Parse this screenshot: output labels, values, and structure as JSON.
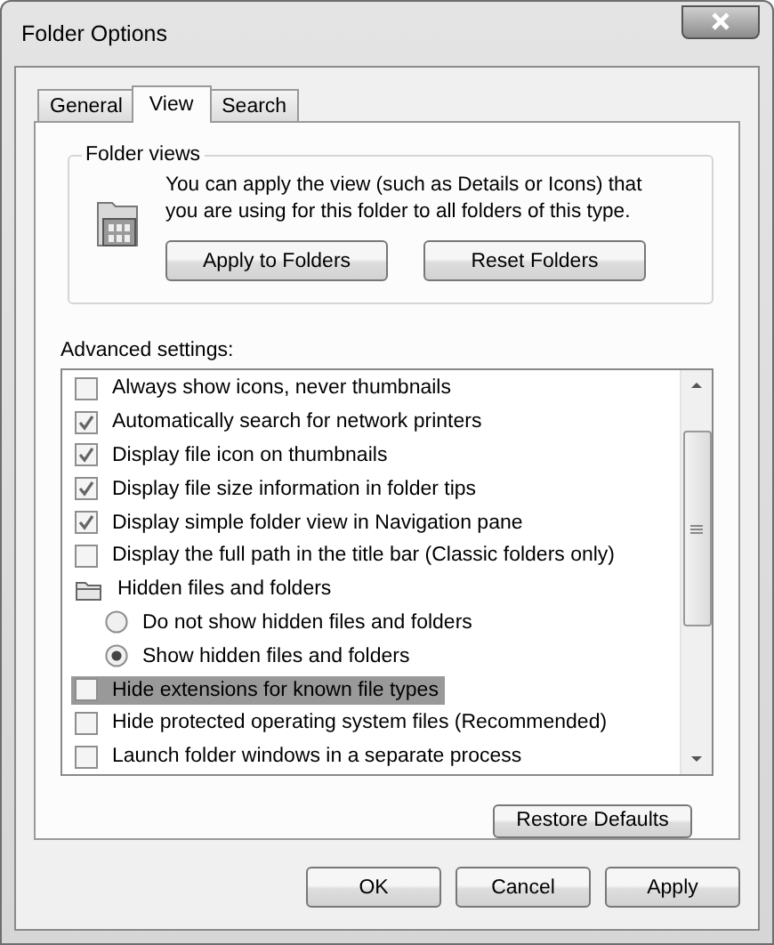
{
  "window": {
    "title": "Folder Options"
  },
  "tabs": [
    {
      "label": "General",
      "selected": false
    },
    {
      "label": "View",
      "selected": true
    },
    {
      "label": "Search",
      "selected": false
    }
  ],
  "folder_views": {
    "title": "Folder views",
    "description": "You can apply the view (such as Details or Icons) that you are using for this folder to all folders of this type.",
    "buttons": [
      "Apply to Folders",
      "Reset Folders"
    ]
  },
  "advanced_settings": {
    "label": "Advanced settings:",
    "items": [
      {
        "kind": "checkbox",
        "label": "Always show icons, never thumbnails",
        "checked": false,
        "selected": false
      },
      {
        "kind": "checkbox",
        "label": "Automatically search for network printers",
        "checked": true,
        "selected": false
      },
      {
        "kind": "checkbox",
        "label": "Display file icon on thumbnails",
        "checked": true,
        "selected": false
      },
      {
        "kind": "checkbox",
        "label": "Display file size information in folder tips",
        "checked": true,
        "selected": false
      },
      {
        "kind": "checkbox",
        "label": "Display simple folder view in Navigation pane",
        "checked": true,
        "selected": false
      },
      {
        "kind": "checkbox",
        "label": "Display the full path in the title bar (Classic folders only)",
        "checked": false,
        "selected": false
      },
      {
        "kind": "group",
        "label": "Hidden files and folders",
        "selected": false,
        "children": [
          {
            "kind": "radio",
            "label": "Do not show hidden files and folders",
            "checked": false,
            "selected": false
          },
          {
            "kind": "radio",
            "label": "Show hidden files and folders",
            "checked": true,
            "selected": false
          }
        ]
      },
      {
        "kind": "checkbox",
        "label": "Hide extensions for known file types",
        "checked": false,
        "selected": true
      },
      {
        "kind": "checkbox",
        "label": "Hide protected operating system files (Recommended)",
        "checked": false,
        "selected": false
      },
      {
        "kind": "checkbox",
        "label": "Launch folder windows in a separate process",
        "checked": false,
        "selected": false
      }
    ],
    "restore_button": "Restore Defaults"
  },
  "buttons": [
    "OK",
    "Cancel",
    "Apply"
  ]
}
